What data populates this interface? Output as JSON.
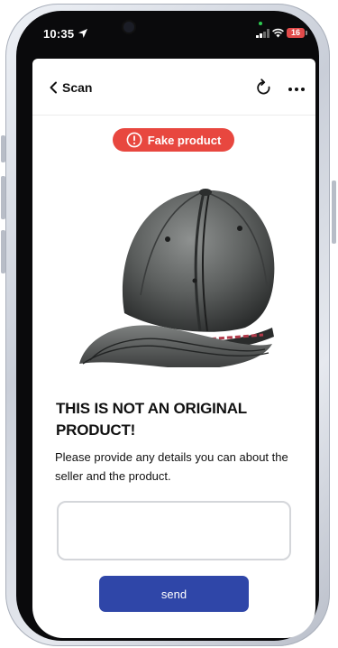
{
  "status_bar": {
    "time": "10:35",
    "battery_level": "16"
  },
  "nav": {
    "back_label": "Scan",
    "refresh_icon": "refresh-icon",
    "more_icon": "more-horizontal-icon"
  },
  "badge": {
    "label": "Fake product",
    "icon": "alert-circle-icon",
    "color": "#e8473f"
  },
  "product_image": {
    "icon": "baseball-cap-image"
  },
  "message": {
    "headline": "THIS IS NOT AN ORIGINAL PRODUCT!",
    "body": "Please provide any details you can about the seller and the product."
  },
  "details_input": {
    "value": "",
    "placeholder": ""
  },
  "send_button": {
    "label": "send",
    "color": "#2f46a8"
  }
}
